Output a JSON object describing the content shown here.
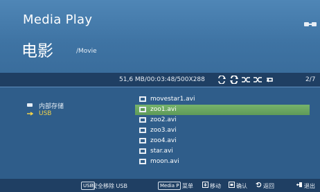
{
  "header": {
    "app_title": "Media Play",
    "section_title": "电影",
    "path": "/Movie"
  },
  "info_bar": {
    "file_info": "51,6 MB/00:03:48/500X288",
    "page": "2/7",
    "controls": [
      "repeat-one-icon",
      "repeat-all-icon",
      "shuffle-icon",
      "shuffle-off-icon",
      "repeat-off-icon"
    ]
  },
  "storage": [
    {
      "label": "内部存储",
      "icon": "drive-icon",
      "selected": false
    },
    {
      "label": "USB",
      "icon": "usb-icon",
      "selected": true
    }
  ],
  "files": [
    {
      "name": "movestar1.avi",
      "selected": false
    },
    {
      "name": "zoo1.avi",
      "selected": true
    },
    {
      "name": "zoo2.avi",
      "selected": false
    },
    {
      "name": "zoo3.avi",
      "selected": false
    },
    {
      "name": "zoo4.avi",
      "selected": false
    },
    {
      "name": "star.avi",
      "selected": false
    },
    {
      "name": "moon.avi",
      "selected": false
    }
  ],
  "footer": {
    "usb_chip": "USB",
    "safe_remove": "安全移除 USB",
    "menu_chip": "Media P",
    "menu_label": "菜单",
    "move_label": "移动",
    "confirm_label": "确认",
    "back_label": "返回",
    "exit_label": "退出"
  },
  "colors": {
    "background": "#2f5d8a",
    "header": "#3e73a3",
    "bar": "#1f3f63",
    "selected_row": "#6aa862",
    "usb_text": "#f2d24a"
  }
}
